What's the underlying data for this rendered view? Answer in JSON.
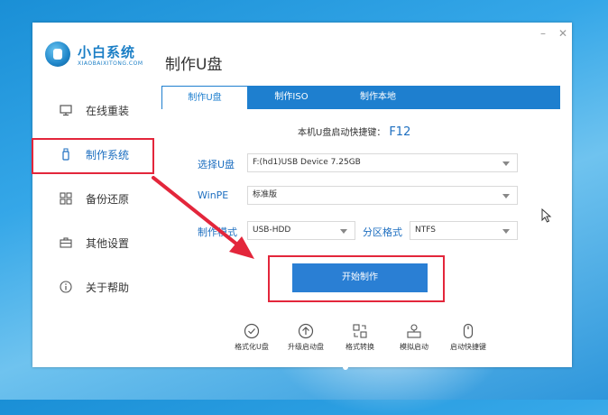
{
  "app": {
    "logo_title": "小白系统",
    "logo_subtitle": "XIAOBAIXITONG.COM",
    "page_title": "制作U盘"
  },
  "sidebar": {
    "items": [
      {
        "label": "在线重装",
        "icon": "monitor-icon"
      },
      {
        "label": "制作系统",
        "icon": "usb-drive-icon"
      },
      {
        "label": "备份还原",
        "icon": "backup-icon"
      },
      {
        "label": "其他设置",
        "icon": "briefcase-icon"
      },
      {
        "label": "关于帮助",
        "icon": "info-icon"
      }
    ],
    "active_index": 1
  },
  "tabs": [
    {
      "label": "制作U盘",
      "active": true
    },
    {
      "label": "制作ISO",
      "active": false
    },
    {
      "label": "制作本地",
      "active": false
    }
  ],
  "hotkey": {
    "label": "本机U盘启动快捷键：",
    "key": "F12"
  },
  "form": {
    "usb_label": "选择U盘",
    "usb_value": "F:(hd1)USB Device 7.25GB",
    "winpe_label": "WinPE",
    "winpe_value": "标准版",
    "mode_label": "制作模式",
    "mode_value": "USB-HDD",
    "partition_label": "分区格式",
    "partition_value": "NTFS"
  },
  "start_button": "开始制作",
  "tools": [
    {
      "label": "格式化U盘",
      "icon": "check-circle-icon"
    },
    {
      "label": "升级启动盘",
      "icon": "upload-circle-icon"
    },
    {
      "label": "格式转换",
      "icon": "convert-icon"
    },
    {
      "label": "模拟启动",
      "icon": "simulate-icon"
    },
    {
      "label": "启动快捷键",
      "icon": "mouse-icon"
    }
  ],
  "colors": {
    "accent": "#1e7fcf",
    "highlight": "#e3263b",
    "button": "#2a7fd4"
  }
}
